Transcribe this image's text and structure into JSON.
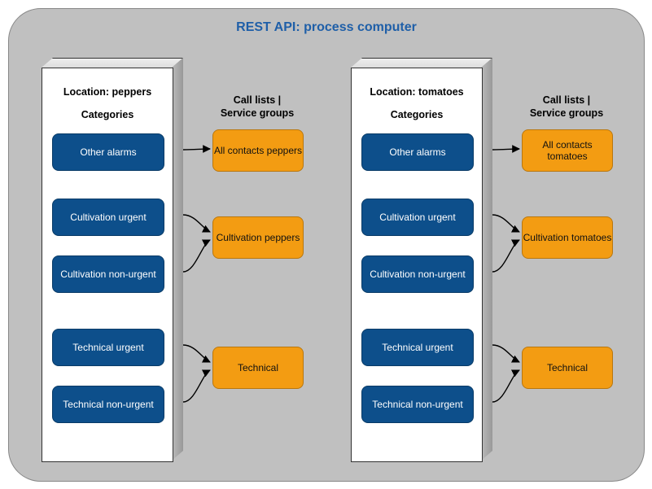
{
  "title": "REST API: process computer",
  "serviceGroupsHeader": "Call lists |\nService groups",
  "categoriesHeader": "Categories",
  "locations": [
    {
      "id": "peppers",
      "label": "Location: peppers",
      "categories": [
        "Other alarms",
        "Cultivation urgent",
        "Cultivation non-urgent",
        "Technical urgent",
        "Technical non-urgent"
      ],
      "serviceGroups": [
        "All contacts peppers",
        "Cultivation peppers",
        "Technical"
      ]
    },
    {
      "id": "tomatoes",
      "label": "Location: tomatoes",
      "categories": [
        "Other alarms",
        "Cultivation urgent",
        "Cultivation non-urgent",
        "Technical urgent",
        "Technical non-urgent"
      ],
      "serviceGroups": [
        "All contacts tomatoes",
        "Cultivation tomatoes",
        "Technical"
      ]
    }
  ],
  "mappings": [
    {
      "from": 0,
      "to": 0
    },
    {
      "from": 1,
      "to": 1
    },
    {
      "from": 2,
      "to": 1
    },
    {
      "from": 3,
      "to": 2
    },
    {
      "from": 4,
      "to": 2
    }
  ],
  "colors": {
    "panel": "#c0c0c0",
    "title": "#1f5fa8",
    "category": "#0d4f8b",
    "serviceGroup": "#f39c12"
  }
}
